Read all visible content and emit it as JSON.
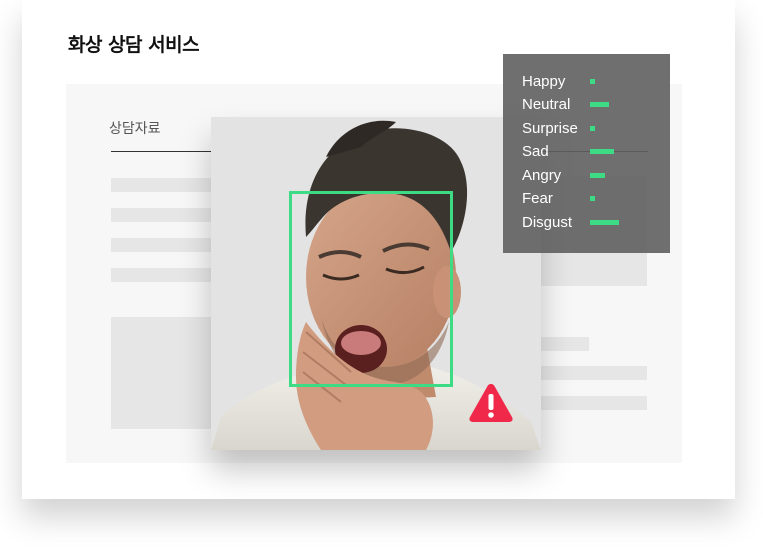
{
  "header": {
    "title": "화상 상담 서비스"
  },
  "document": {
    "tab_label": "상담자료"
  },
  "colors": {
    "accent": "#3ddc84",
    "warning": "#f0284a",
    "panel": "#5f5f5f"
  },
  "alert": {
    "icon": "warning-icon"
  },
  "emotions": [
    {
      "label": "Happy",
      "level": 0.15
    },
    {
      "label": "Neutral",
      "level": 0.55
    },
    {
      "label": "Surprise",
      "level": 0.15
    },
    {
      "label": "Sad",
      "level": 0.7
    },
    {
      "label": "Angry",
      "level": 0.45
    },
    {
      "label": "Fear",
      "level": 0.15
    },
    {
      "label": "Disgust",
      "level": 0.85
    }
  ]
}
